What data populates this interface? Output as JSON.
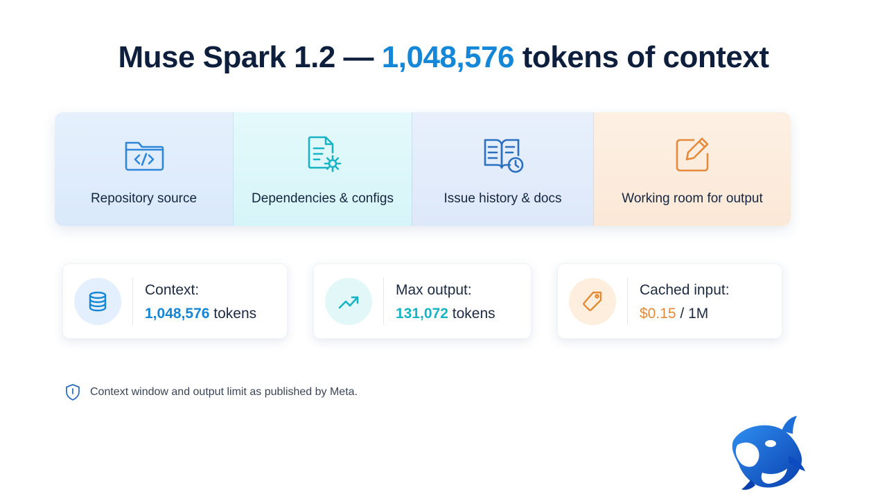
{
  "title": {
    "prefix": "Muse Spark 1.2 — ",
    "highlight": "1,048,576",
    "suffix": " tokens of context"
  },
  "segments": [
    {
      "label": "Repository source",
      "icon": "code-folder-icon",
      "color": "#2d86d8"
    },
    {
      "label": "Dependencies & configs",
      "icon": "document-gear-icon",
      "color": "#18b3c4"
    },
    {
      "label": "Issue history & docs",
      "icon": "book-clock-icon",
      "color": "#2a6fc0"
    },
    {
      "label": "Working room for output",
      "icon": "edit-pencil-icon",
      "color": "#e5893a"
    }
  ],
  "stats": [
    {
      "label": "Context:",
      "value": "1,048,576",
      "unit": " tokens",
      "icon": "database-icon",
      "color": "#1486d6"
    },
    {
      "label": "Max output:",
      "value": "131,072",
      "unit": " tokens",
      "icon": "trend-up-icon",
      "color": "#16b4c4"
    },
    {
      "label": "Cached input:",
      "value": "$0.15",
      "unit": " / 1M",
      "icon": "price-tag-icon",
      "color": "#e58a34"
    }
  ],
  "footnote": {
    "text": "Context window and output limit as published by Meta.",
    "icon": "shield-icon"
  },
  "mascot": {
    "icon": "orca-mascot-icon"
  }
}
